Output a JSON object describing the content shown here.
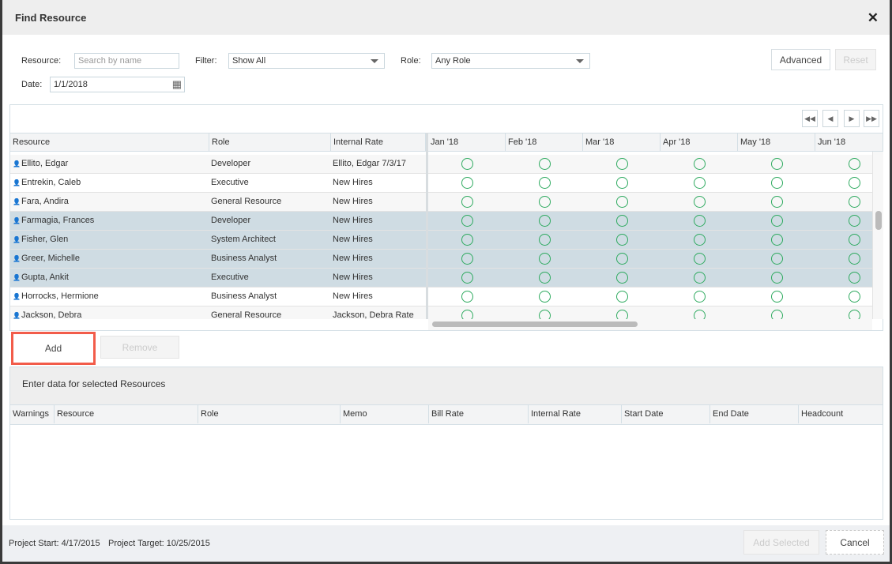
{
  "dialog": {
    "title": "Find Resource",
    "close_icon": "close-icon"
  },
  "filters": {
    "resource_label": "Resource:",
    "resource_placeholder": "Search by name",
    "filter_label": "Filter:",
    "filter_value": "Show All",
    "role_label": "Role:",
    "role_value": "Any Role",
    "date_label": "Date:",
    "date_value": "1/1/2018",
    "advanced": "Advanced",
    "reset": "Reset"
  },
  "grid": {
    "columns": [
      "Resource",
      "Role",
      "Internal Rate"
    ],
    "months": [
      "Jan '18",
      "Feb '18",
      "Mar '18",
      "Apr '18",
      "May '18",
      "Jun '18"
    ],
    "rows": [
      {
        "name": "Ellito, Edgar",
        "role": "Developer",
        "rate": "Ellito, Edgar 7/3/17",
        "selected": false
      },
      {
        "name": "Entrekin, Caleb",
        "role": "Executive",
        "rate": "New Hires",
        "selected": false
      },
      {
        "name": "Fara, Andira",
        "role": "General Resource",
        "rate": "New Hires",
        "selected": false
      },
      {
        "name": "Farmagia, Frances",
        "role": "Developer",
        "rate": "New Hires",
        "selected": true
      },
      {
        "name": "Fisher, Glen",
        "role": "System Architect",
        "rate": "New Hires",
        "selected": true
      },
      {
        "name": "Greer, Michelle",
        "role": "Business Analyst",
        "rate": "New Hires",
        "selected": true
      },
      {
        "name": "Gupta, Ankit",
        "role": "Executive",
        "rate": "New Hires",
        "selected": true
      },
      {
        "name": "Horrocks, Hermione",
        "role": "Business Analyst",
        "rate": "New Hires",
        "selected": false
      },
      {
        "name": "Jackson, Debra",
        "role": "General Resource",
        "rate": "Jackson, Debra Rate",
        "selected": false
      }
    ],
    "availability_color": "#2eaa5f",
    "selected_row_color": "#cfdce3"
  },
  "actions": {
    "add": "Add",
    "remove": "Remove",
    "highlight_color": "#f25c4a"
  },
  "selected": {
    "title": "Enter data for selected Resources",
    "columns": [
      "Warnings",
      "Resource",
      "Role",
      "Memo",
      "Bill Rate",
      "Internal Rate",
      "Start Date",
      "End Date",
      "Headcount"
    ]
  },
  "footer": {
    "project_start": "Project Start: 4/17/2015",
    "project_target": "Project Target: 10/25/2015",
    "add_selected": "Add Selected",
    "cancel": "Cancel"
  }
}
